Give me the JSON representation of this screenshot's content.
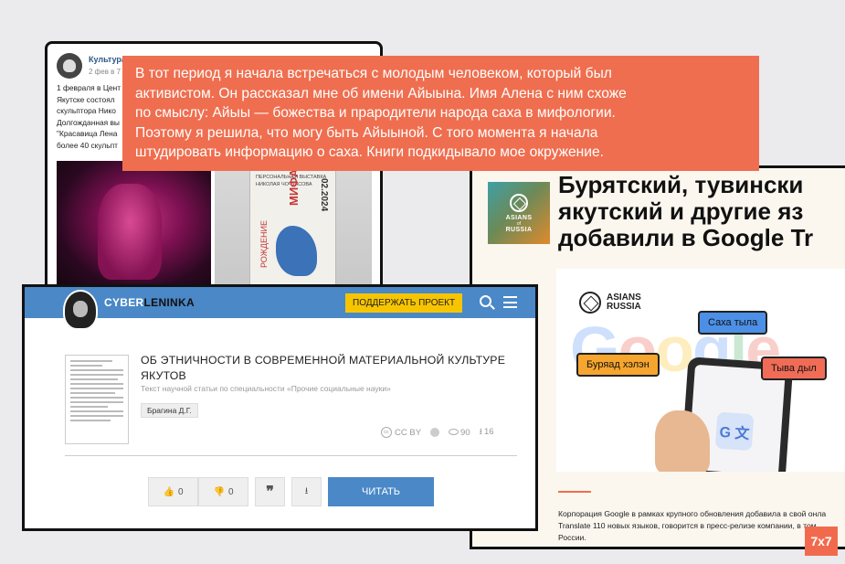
{
  "vk_post": {
    "group_name": "Культура",
    "date": "2 фев в 7",
    "text_lines": [
      "1 февраля в Цент",
      "Якутске состоял",
      "скульптора Нико",
      "Долгожданная вы",
      "\"Красавица Лена",
      "более 40 скульпт"
    ],
    "poster": {
      "lines": [
        "ПЕРСОНАЛЬНАЯ ВЫСТАВКА",
        "НИКОЛАЯ ЧОЧУАСОВА"
      ],
      "mifa": "МИФА",
      "rozhdenie": "РОЖДЕНИЕ",
      "year": "02.2024"
    }
  },
  "quote": {
    "lines": [
      "В тот период я начала встречаться с молодым человеком, который был",
      "активистом. Он рассказал мне об имени Айыына. Имя Алена с ним схоже",
      "по смыслу: Айыы — божества и прародители народа саха в мифологии.",
      "Поэтому я решила, что могу быть Айыыной. С того момента я начала",
      "штудировать информацию о саха. Книги подкидывало мое окружение."
    ]
  },
  "asians_of_russia": {
    "logo_line1": "ASIANS",
    "logo_line2": "of",
    "logo_line3": "RUSSIA",
    "headline_lines": [
      "Бурятский, тувински",
      "якутский и другие яз",
      "добавили в Google Tr"
    ],
    "image": {
      "brand_line1": "ASIANS",
      "brand_line2": "RUSSIA",
      "google_word": [
        "G",
        "o",
        "o",
        "g",
        "l",
        "e"
      ],
      "bubble_blue": "Саха тыла",
      "bubble_orange": "Буряад хэлэн",
      "bubble_red": "Тыва дыл",
      "translate_glyph": "G 文"
    },
    "body_lines": [
      "Корпорация Google в рамках крупного обновления добавила в свой онла",
      "Translate 110 новых языков, говорится в пресс-релизе компании, в том",
      "России."
    ]
  },
  "cyberleninka": {
    "logo_part1": "CYBER",
    "logo_part2": "LENINKA",
    "support_button": "ПОДДЕРЖАТЬ ПРОЕКТ",
    "title_lines": [
      "ОБ ЭТНИЧНОСТИ В СОВРЕМЕННОЙ МАТЕРИАЛЬНОЙ КУЛЬТУРЕ",
      "ЯКУТОВ"
    ],
    "subtitle": "Текст научной статьи по специальности «Прочие социальные науки»",
    "author": "Брагина Д.Г.",
    "license": "CC BY",
    "views": "90",
    "downloads": "16",
    "likes": "0",
    "dislikes": "0",
    "cite_glyph": "❞",
    "read_button": "ЧИТАТЬ"
  },
  "badge": "7x7"
}
